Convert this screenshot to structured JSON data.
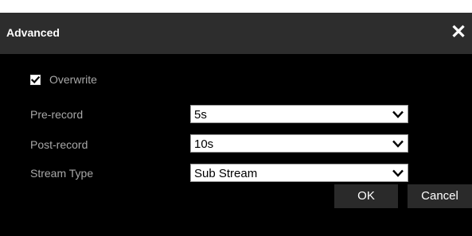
{
  "dialog": {
    "title": "Advanced",
    "close_icon": "close-icon",
    "close_glyph": "✕"
  },
  "overwrite": {
    "label": "Overwrite",
    "checked": true,
    "icon": "checkmark-icon"
  },
  "fields": {
    "pre_record": {
      "label": "Pre-record",
      "value": "5s",
      "icon": "chevron-down-icon"
    },
    "post_record": {
      "label": "Post-record",
      "value": "10s",
      "icon": "chevron-down-icon"
    },
    "stream_type": {
      "label": "Stream Type",
      "value": "Sub Stream",
      "icon": "chevron-down-icon"
    }
  },
  "buttons": {
    "ok": "OK",
    "cancel": "Cancel"
  },
  "colors": {
    "titlebar": "#2d2d2d",
    "body": "#000000",
    "label_text": "#a8a8a8",
    "button_bg": "#2a2a2a"
  }
}
